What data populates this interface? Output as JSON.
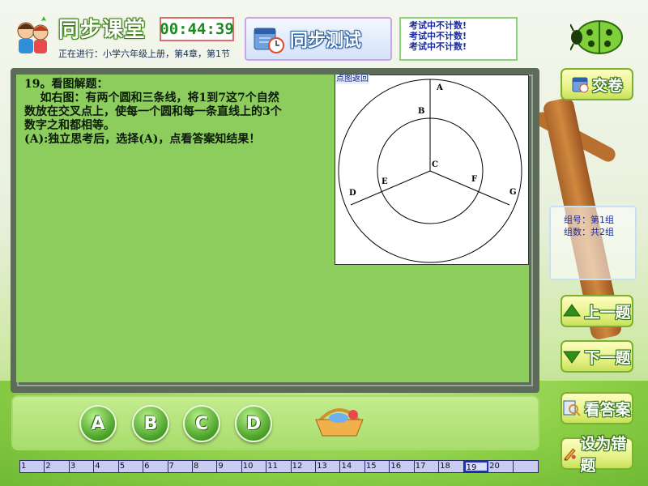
{
  "header": {
    "app_title": "同步课堂",
    "progress_text": "正在进行：小学六年级上册，第4章，第1节",
    "timer": "00:44:39",
    "mode_label": "同步测试",
    "notice_lines": [
      "考试中不计数!",
      "考试中不计数!",
      "考试中不计数!"
    ]
  },
  "question": {
    "text": "19。看图解题：\n    如右图：有两个圆和三条线，将1到7这7个自然数放在交叉点上，使每一个圆和每一条直线上的3个数字之和都相等。\n(A):独立思考后，选择(A)，点看答案知结果！"
  },
  "diagram": {
    "caption": "点图返回",
    "labels": [
      "A",
      "B",
      "C",
      "D",
      "E",
      "F",
      "G"
    ]
  },
  "group_info": {
    "group_label": "组号：第1组",
    "count_label": "组数：共2组"
  },
  "buttons": {
    "submit": "交卷",
    "prev": "上一题",
    "next": "下一题",
    "answer": "看答案",
    "wrong": "设为错题"
  },
  "options": [
    "A",
    "B",
    "C",
    "D"
  ],
  "navigator": {
    "numbers": [
      "1",
      "2",
      "3",
      "4",
      "5",
      "6",
      "7",
      "8",
      "9",
      "10",
      "11",
      "12",
      "13",
      "14",
      "15",
      "16",
      "17",
      "18",
      "19",
      "20"
    ],
    "current": "19"
  },
  "colors": {
    "board_fill": "#8ccd5d",
    "timer_text": "#1d8a22",
    "notice_text": "#1a2aa0"
  }
}
